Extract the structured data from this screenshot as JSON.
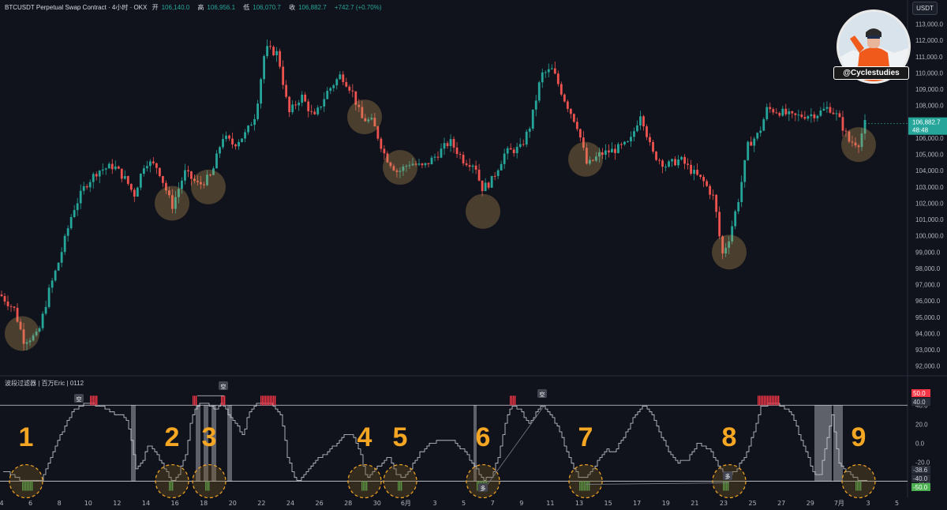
{
  "header": {
    "symbol": "BTCUSDT Perpetual Swap Contract · 4小时 · OKX",
    "open_label": "开",
    "open": "106,140.0",
    "high_label": "高",
    "high": "106,956.1",
    "low_label": "低",
    "low": "106,070.7",
    "close_label": "收",
    "close": "106,882.7",
    "change": "+742.7 (+0.70%)"
  },
  "currency_button": "USDT",
  "brand": {
    "handle": "@Cyclestudies"
  },
  "indicator": {
    "title": "波段过滤器 | 百万Eric | 0112"
  },
  "price_tag": {
    "value": "106,882.7",
    "countdown": "48:48"
  },
  "colors": {
    "up": "#26a69a",
    "down": "#ef5350",
    "highlight": "#f5a623",
    "osc_line": "#cfd3da"
  },
  "chart_data": [
    {
      "type": "candlestick",
      "title": "",
      "ylim": [
        91600,
        113800
      ],
      "y_ticks": [
        "113,000.0",
        "112,000.0",
        "111,000.0",
        "110,000.0",
        "109,000.0",
        "108,000.0",
        "107,000.0",
        "106,000.0",
        "105,000.0",
        "104,000.0",
        "103,000.0",
        "102,000.0",
        "101,000.0",
        "100,000.0",
        "99,000.0",
        "98,000.0",
        "97,000.0",
        "96,000.0",
        "95,000.0",
        "94,000.0",
        "93,000.0",
        "92,000.0"
      ],
      "x_ticks": [
        "4",
        "6",
        "8",
        "10",
        "12",
        "14",
        "16",
        "18",
        "20",
        "22",
        "24",
        "26",
        "28",
        "30",
        "6月",
        "3",
        "5",
        "7",
        "9",
        "11",
        "13",
        "15",
        "17",
        "19",
        "21",
        "23",
        "25",
        "27",
        "29",
        "7月",
        "3",
        "5"
      ],
      "path_points": [
        [
          0,
          96400
        ],
        [
          18,
          95500
        ],
        [
          30,
          93600
        ],
        [
          48,
          93900
        ],
        [
          62,
          96600
        ],
        [
          75,
          98500
        ],
        [
          92,
          101500
        ],
        [
          108,
          103100
        ],
        [
          124,
          104000
        ],
        [
          144,
          104300
        ],
        [
          160,
          103400
        ],
        [
          170,
          102500
        ],
        [
          184,
          104600
        ],
        [
          200,
          104200
        ],
        [
          218,
          101800
        ],
        [
          234,
          103900
        ],
        [
          252,
          103100
        ],
        [
          268,
          103700
        ],
        [
          282,
          106100
        ],
        [
          296,
          105600
        ],
        [
          312,
          106300
        ],
        [
          324,
          107500
        ],
        [
          336,
          111500
        ],
        [
          352,
          111200
        ],
        [
          366,
          107500
        ],
        [
          382,
          108600
        ],
        [
          398,
          107200
        ],
        [
          414,
          108800
        ],
        [
          432,
          109900
        ],
        [
          446,
          108900
        ],
        [
          458,
          107200
        ],
        [
          472,
          107000
        ],
        [
          488,
          104900
        ],
        [
          504,
          103900
        ],
        [
          520,
          104500
        ],
        [
          536,
          104200
        ],
        [
          552,
          104900
        ],
        [
          570,
          105800
        ],
        [
          588,
          104600
        ],
        [
          602,
          104400
        ],
        [
          610,
          102900
        ],
        [
          622,
          103300
        ],
        [
          640,
          105100
        ],
        [
          660,
          105400
        ],
        [
          672,
          106800
        ],
        [
          686,
          109900
        ],
        [
          700,
          110200
        ],
        [
          716,
          108300
        ],
        [
          732,
          106700
        ],
        [
          744,
          104300
        ],
        [
          760,
          105000
        ],
        [
          780,
          105300
        ],
        [
          798,
          105700
        ],
        [
          812,
          107600
        ],
        [
          826,
          105100
        ],
        [
          844,
          104300
        ],
        [
          862,
          104700
        ],
        [
          878,
          103900
        ],
        [
          892,
          103300
        ],
        [
          905,
          102300
        ],
        [
          915,
          98800
        ],
        [
          924,
          99900
        ],
        [
          936,
          102300
        ],
        [
          948,
          105600
        ],
        [
          962,
          106300
        ],
        [
          972,
          107800
        ],
        [
          990,
          107600
        ],
        [
          1004,
          107300
        ],
        [
          1020,
          107400
        ],
        [
          1036,
          107500
        ],
        [
          1050,
          107900
        ],
        [
          1062,
          107300
        ],
        [
          1076,
          105800
        ],
        [
          1088,
          105700
        ],
        [
          1096,
          106883
        ]
      ],
      "highlight_price_levels": [
        94000,
        102000,
        103000,
        107300,
        104200,
        101500,
        104700,
        99000,
        105600
      ]
    },
    {
      "type": "line",
      "name": "波段过滤器",
      "ylim": [
        -52,
        56
      ],
      "y_ticks": [
        40,
        20,
        0,
        -20,
        -40
      ],
      "value_labels": [
        {
          "text": "50.0",
          "color": "#f23645"
        },
        {
          "text": "40.0",
          "color": "#b2b5be"
        },
        {
          "text": "-38.6",
          "color": "#b2b5be"
        },
        {
          "text": "-40.0",
          "color": "#b2b5be"
        },
        {
          "text": "-50.0",
          "color": "#4caf50"
        }
      ],
      "upper_band": 40,
      "lower_band": -40,
      "path_points": [
        [
          4,
          -30
        ],
        [
          14,
          -32
        ],
        [
          24,
          -38
        ],
        [
          38,
          -40
        ],
        [
          52,
          -38
        ],
        [
          62,
          -18
        ],
        [
          72,
          2
        ],
        [
          82,
          18
        ],
        [
          92,
          34
        ],
        [
          102,
          40
        ],
        [
          112,
          42
        ],
        [
          122,
          40
        ],
        [
          132,
          38
        ],
        [
          146,
          30
        ],
        [
          158,
          28
        ],
        [
          164,
          14
        ],
        [
          172,
          -28
        ],
        [
          180,
          -20
        ],
        [
          188,
          0
        ],
        [
          198,
          -10
        ],
        [
          210,
          -30
        ],
        [
          218,
          -40
        ],
        [
          226,
          -32
        ],
        [
          236,
          -10
        ],
        [
          242,
          26
        ],
        [
          250,
          40
        ],
        [
          256,
          42
        ],
        [
          264,
          40
        ],
        [
          272,
          36
        ],
        [
          282,
          42
        ],
        [
          292,
          26
        ],
        [
          300,
          18
        ],
        [
          308,
          8
        ],
        [
          314,
          32
        ],
        [
          322,
          40
        ],
        [
          334,
          42
        ],
        [
          346,
          40
        ],
        [
          356,
          30
        ],
        [
          364,
          -14
        ],
        [
          372,
          -36
        ],
        [
          378,
          -40
        ],
        [
          390,
          -28
        ],
        [
          402,
          -16
        ],
        [
          414,
          -10
        ],
        [
          426,
          0
        ],
        [
          436,
          8
        ],
        [
          446,
          10
        ],
        [
          456,
          -10
        ],
        [
          464,
          -38
        ],
        [
          472,
          -30
        ],
        [
          482,
          -22
        ],
        [
          492,
          -14
        ],
        [
          502,
          -32
        ],
        [
          510,
          -38
        ],
        [
          520,
          -26
        ],
        [
          532,
          -10
        ],
        [
          546,
          0
        ],
        [
          560,
          4
        ],
        [
          574,
          2
        ],
        [
          590,
          -10
        ],
        [
          602,
          -26
        ],
        [
          612,
          -38
        ],
        [
          622,
          -36
        ],
        [
          632,
          -12
        ],
        [
          642,
          30
        ],
        [
          650,
          40
        ],
        [
          660,
          34
        ],
        [
          670,
          20
        ],
        [
          680,
          34
        ],
        [
          688,
          40
        ],
        [
          698,
          30
        ],
        [
          710,
          10
        ],
        [
          722,
          -18
        ],
        [
          734,
          -38
        ],
        [
          746,
          -34
        ],
        [
          756,
          -20
        ],
        [
          768,
          -6
        ],
        [
          778,
          -10
        ],
        [
          792,
          10
        ],
        [
          806,
          32
        ],
        [
          816,
          40
        ],
        [
          826,
          30
        ],
        [
          836,
          10
        ],
        [
          848,
          -10
        ],
        [
          858,
          -20
        ],
        [
          870,
          -18
        ],
        [
          884,
          0
        ],
        [
          898,
          -6
        ],
        [
          910,
          -24
        ],
        [
          922,
          -36
        ],
        [
          932,
          -28
        ],
        [
          944,
          -14
        ],
        [
          956,
          14
        ],
        [
          964,
          38
        ],
        [
          974,
          42
        ],
        [
          990,
          40
        ],
        [
          1002,
          32
        ],
        [
          1012,
          10
        ],
        [
          1022,
          -12
        ],
        [
          1030,
          -30
        ],
        [
          1038,
          -36
        ],
        [
          1046,
          -2
        ],
        [
          1054,
          30
        ],
        [
          1062,
          -20
        ],
        [
          1072,
          -30
        ],
        [
          1080,
          -34
        ],
        [
          1088,
          -40
        ],
        [
          1096,
          -38
        ]
      ],
      "signal_numbers": [
        "1",
        "2",
        "3",
        "4",
        "5",
        "6",
        "7",
        "8",
        "9"
      ],
      "short_markers": [
        "空",
        "空",
        "空"
      ],
      "long_markers": [
        "多",
        "多"
      ]
    }
  ]
}
